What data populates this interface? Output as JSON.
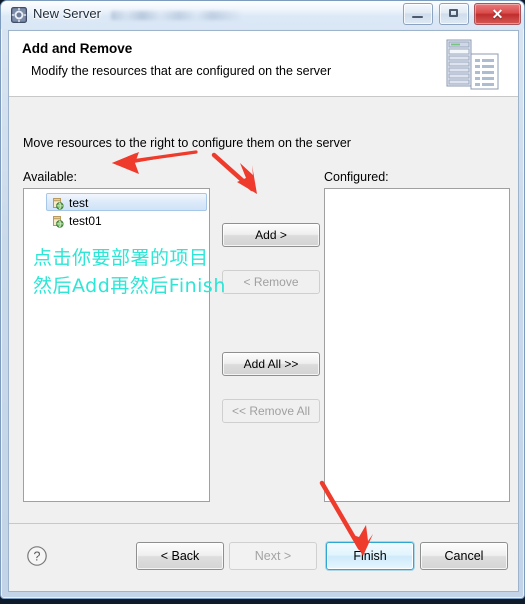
{
  "window": {
    "title": "New Server",
    "icon": "server-gear-icon",
    "controls": {
      "minimize": "minimize-icon",
      "maximize": "maximize-icon",
      "close": "✕"
    }
  },
  "header": {
    "title": "Add and Remove",
    "subtitle": "Modify the resources that are configured on the server",
    "icon": "server-and-document-icon"
  },
  "body": {
    "intro": "Move resources to the right to configure them on the server",
    "available": {
      "label": "Available:",
      "items": [
        {
          "name": "test",
          "icon": "web-project-icon",
          "selected": true
        },
        {
          "name": "test01",
          "icon": "web-project-icon",
          "selected": false
        }
      ]
    },
    "configured": {
      "label": "Configured:",
      "items": []
    },
    "transfer_buttons": [
      {
        "id": "add",
        "label": "Add >",
        "enabled": true
      },
      {
        "id": "remove",
        "label": "< Remove",
        "enabled": false
      },
      {
        "id": "add-all",
        "label": "Add All >>",
        "enabled": true
      },
      {
        "id": "remove-all",
        "label": "<< Remove All",
        "enabled": false
      }
    ]
  },
  "footer": {
    "help_icon": "?",
    "buttons": [
      {
        "id": "back",
        "label": "< Back",
        "enabled": true,
        "default": false
      },
      {
        "id": "next",
        "label": "Next >",
        "enabled": false,
        "default": false
      },
      {
        "id": "finish",
        "label": "Finish",
        "enabled": true,
        "default": true
      },
      {
        "id": "cancel",
        "label": "Cancel",
        "enabled": true,
        "default": false
      }
    ]
  },
  "annotations": {
    "color": "#2ee6d6",
    "arrow_color": "#ef3b2c",
    "note_line1": "点击你要部署的项目",
    "note_line2": "然后Add再然后Finish",
    "arrows": [
      {
        "id": "arrow-to-available-list",
        "points_to": "available-list"
      },
      {
        "id": "arrow-to-add-button",
        "points_to": "add-button"
      },
      {
        "id": "arrow-to-finish-button",
        "points_to": "finish-button"
      }
    ]
  }
}
